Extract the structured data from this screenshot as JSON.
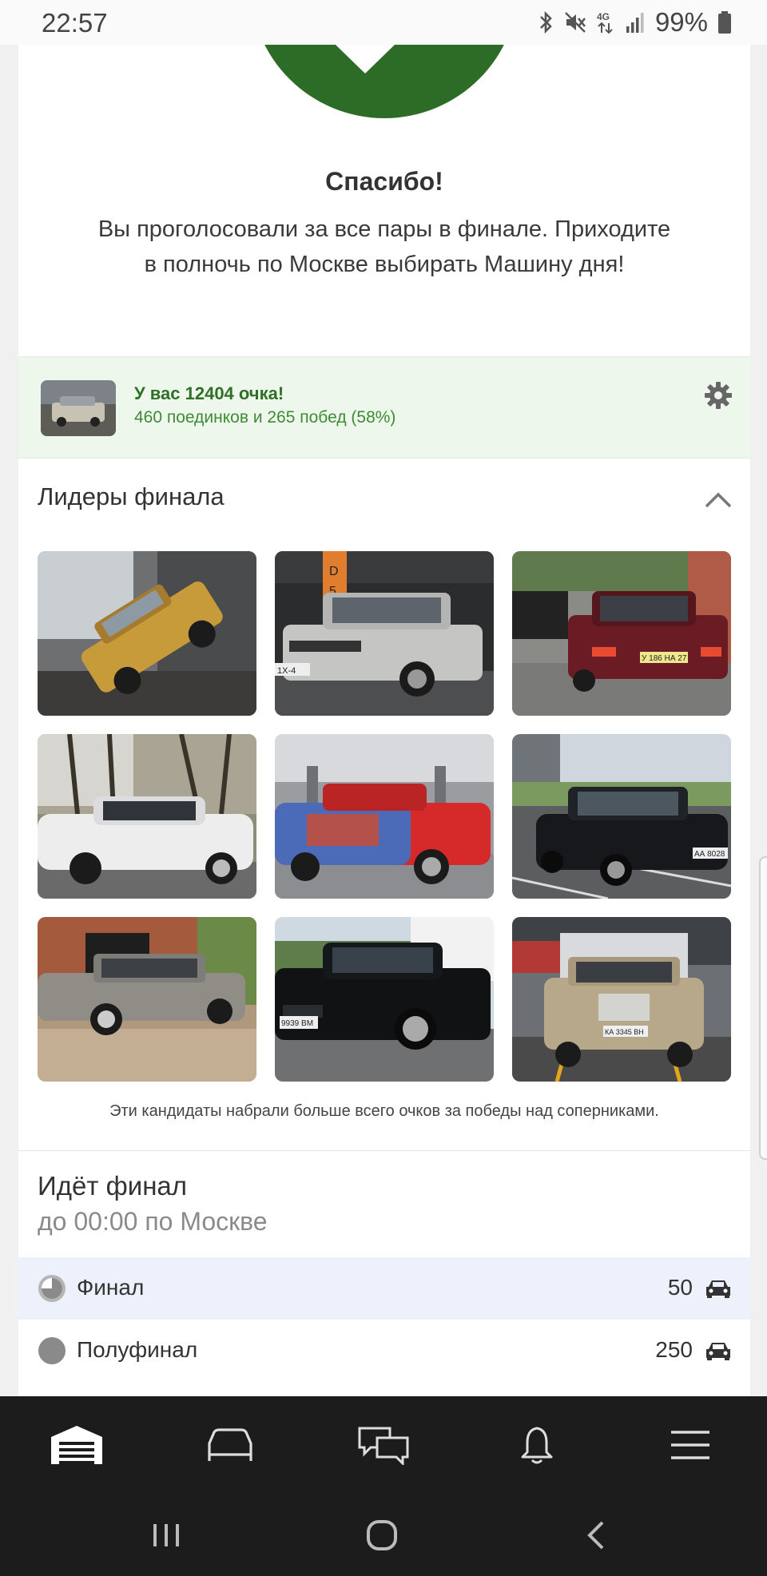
{
  "status_bar": {
    "time": "22:57",
    "battery": "99%",
    "network": "4G"
  },
  "thanks": {
    "title": "Спасибо!",
    "line1": "Вы проголосовали за все пары в финале. Приходите",
    "line2": "в полночь по Москве выбирать Машину дня!"
  },
  "points": {
    "title": "У вас 12404 очка!",
    "subtitle": "460 поединков и 265 побед (58%)"
  },
  "leaders": {
    "title": "Лидеры финала",
    "caption": "Эти кандидаты набрали больше всего очков за победы над соперниками.",
    "plates": [
      "1X-4",
      "У 186 НА 27",
      "",
      "",
      "",
      "АА 8028",
      "",
      "9939 ВМ",
      "КА 3345 ВН"
    ]
  },
  "final": {
    "title": "Идёт финал",
    "subtitle": "до 00:00 по Москве",
    "stages": [
      {
        "label": "Финал",
        "count": "50"
      },
      {
        "label": "Полуфинал",
        "count": "250"
      }
    ]
  },
  "colors": {
    "accent_green": "#2d6c27",
    "banner_bg": "#eef7ec",
    "active_row_bg": "#ecf1fb",
    "nav_bg": "#1c1c1c"
  },
  "icons": {
    "nav": [
      "garage-icon",
      "car-icon",
      "messages-icon",
      "bell-icon",
      "menu-icon"
    ],
    "android": [
      "recents-icon",
      "home-icon",
      "back-icon"
    ]
  }
}
